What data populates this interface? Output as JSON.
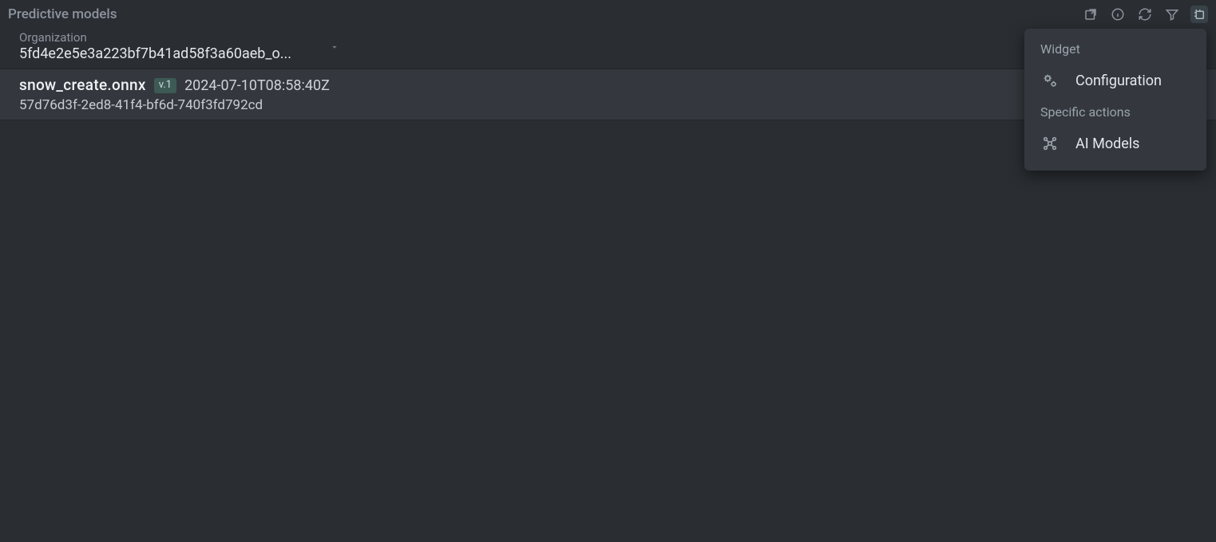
{
  "panel": {
    "title": "Predictive models"
  },
  "organization": {
    "label": "Organization",
    "value": "5fd4e2e5e3a223bf7b41ad58f3a60aeb_o..."
  },
  "models": [
    {
      "name": "snow_create.onnx",
      "version": "v.1",
      "timestamp": "2024-07-10T08:58:40Z",
      "id": "57d76d3f-2ed8-41f4-bf6d-740f3fd792cd"
    }
  ],
  "menu": {
    "section_widget": "Widget",
    "configuration": "Configuration",
    "section_specific": "Specific actions",
    "ai_models": "AI Models"
  }
}
